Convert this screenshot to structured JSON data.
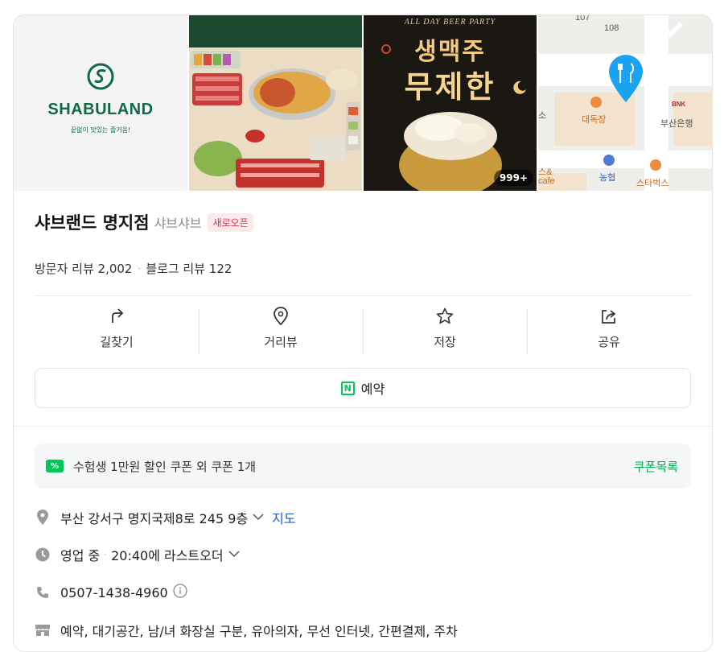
{
  "gallery": {
    "logo": {
      "name": "SHABULAND",
      "tagline": "끝없이 맛있는 즐거움!"
    },
    "beer": {
      "line1": "ALL DAY BEER PARTY",
      "line2": "생맥주",
      "line3": "무제한"
    },
    "photo_count": "999+",
    "map_labels": {
      "n107": "107",
      "n108": "108",
      "daedokjang": "대독장",
      "bnk": "BNK",
      "busan_bank": "부산은행",
      "so": "소",
      "nonghyup": "농협",
      "starbucks": "스타벅스",
      "cafe": "cafe",
      "sung_and": "스&"
    }
  },
  "place": {
    "name": "샤브랜드 명지점",
    "category": "샤브샤브",
    "badge": "새로오픈",
    "visitor_reviews": "방문자 리뷰 2,002",
    "blog_reviews": "블로그 리뷰 122"
  },
  "actions": [
    {
      "label": "길찾기",
      "icon": "directions-icon"
    },
    {
      "label": "거리뷰",
      "icon": "street-view-icon"
    },
    {
      "label": "저장",
      "icon": "star-icon"
    },
    {
      "label": "공유",
      "icon": "share-icon"
    }
  ],
  "reserve": {
    "label": "예약",
    "icon_letter": "N"
  },
  "coupon": {
    "icon_text": "%",
    "text": "수험생 1만원 할인 쿠폰 외 쿠폰 1개",
    "link": "쿠폰목록"
  },
  "address": {
    "text": "부산 강서구 명지국제8로 245 9층",
    "map_link": "지도"
  },
  "hours": {
    "status": "영업 중",
    "detail": "20:40에 라스트오더"
  },
  "phone": "0507-1438-4960",
  "amenities": "예약, 대기공간, 남/녀 화장실 구분, 유아의자, 무선 인터넷, 간편결제, 주차",
  "colors": {
    "accent_green": "#03c75a",
    "link_blue": "#1f5fbf",
    "badge_red": "#e3344a"
  }
}
